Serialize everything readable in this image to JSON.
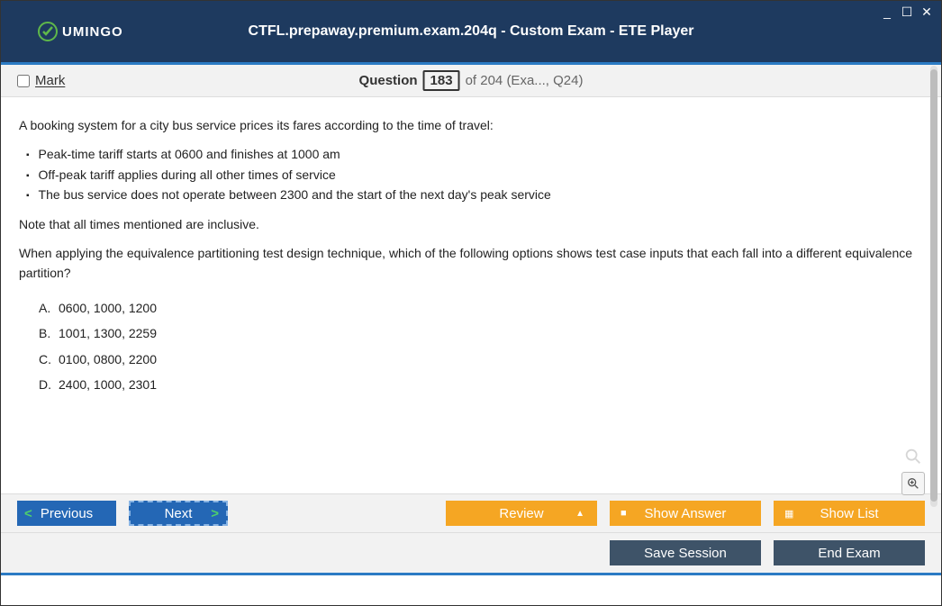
{
  "header": {
    "logo_text": "UMINGO",
    "title": "CTFL.prepaway.premium.exam.204q - Custom Exam - ETE Player"
  },
  "question_bar": {
    "mark_label": "Mark",
    "question_label": "Question",
    "question_number": "183",
    "question_rest": "of 204 (Exa..., Q24)"
  },
  "question": {
    "intro": "A booking system for a city bus service prices its fares according to the time of travel:",
    "bullets": [
      "Peak-time tariff starts at 0600 and finishes at 1000 am",
      "Off-peak tariff applies during all other times of service",
      "The bus service does not operate between 2300 and the start of the next day's peak service"
    ],
    "note": "Note that all times mentioned are inclusive.",
    "prompt": "When applying the equivalence partitioning test design technique, which of the following options shows test case inputs that each fall into a different equivalence partition?",
    "answers": [
      {
        "letter": "A.",
        "text": "0600, 1000, 1200"
      },
      {
        "letter": "B.",
        "text": "1001, 1300, 2259"
      },
      {
        "letter": "C.",
        "text": "0100, 0800, 2200"
      },
      {
        "letter": "D.",
        "text": "2400, 1000, 2301"
      }
    ]
  },
  "buttons": {
    "previous": "Previous",
    "next": "Next",
    "review": "Review",
    "show_answer": "Show Answer",
    "show_list": "Show List",
    "save_session": "Save Session",
    "end_exam": "End Exam"
  }
}
